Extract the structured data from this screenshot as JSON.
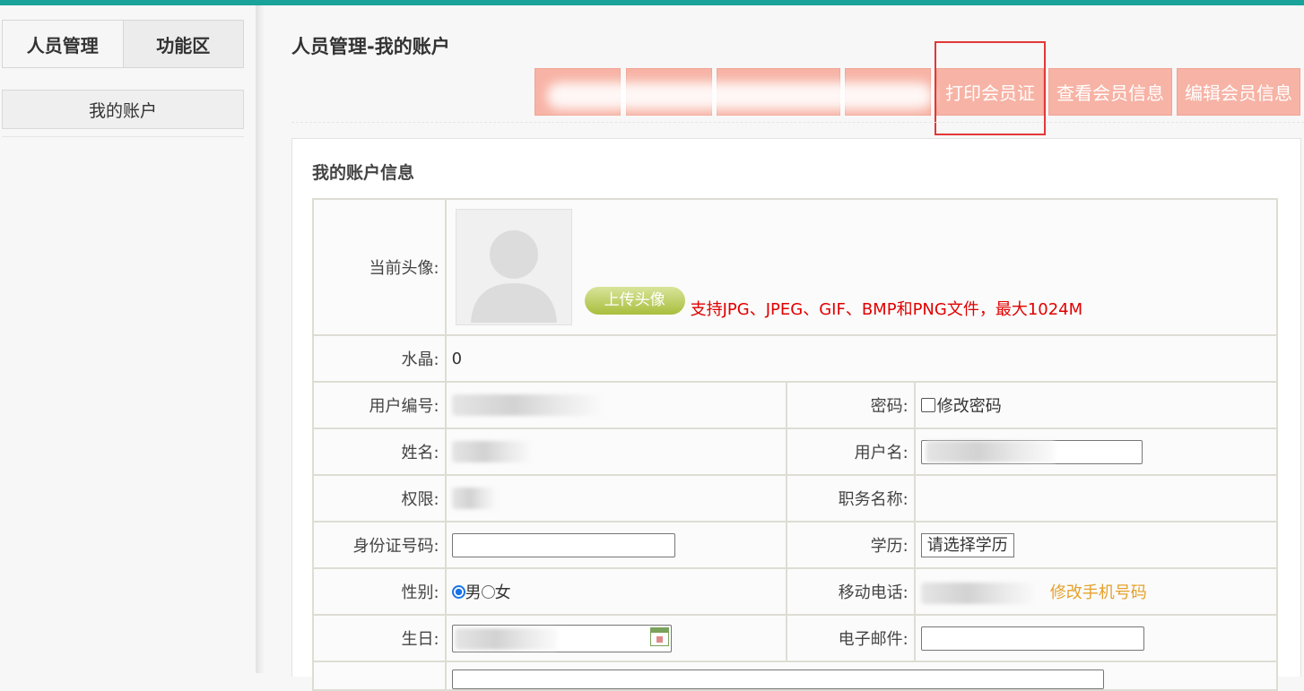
{
  "sidebar": {
    "tabs": [
      "人员管理",
      "功能区"
    ],
    "items": [
      "我的账户"
    ]
  },
  "page_title": "人员管理-我的账户",
  "action_buttons": [
    "",
    "",
    "",
    "",
    "打印会员证",
    "查看会员信息",
    "编辑会员信息"
  ],
  "panel_title": "我的账户信息",
  "avatar": {
    "label": "当前头像:",
    "upload_button": "上传头像",
    "hint": "支持JPG、JPEG、GIF、BMP和PNG文件，最大1024M"
  },
  "fields": {
    "crystal_label": "水晶:",
    "crystal_value": "0",
    "user_no_label": "用户编号:",
    "password_label": "密码:",
    "password_checkbox": "修改密码",
    "name_label": "姓名:",
    "username_label": "用户名:",
    "permission_label": "权限:",
    "job_title_label": "职务名称:",
    "id_card_label": "身份证号码:",
    "education_label": "学历:",
    "education_select": "请选择学历",
    "gender_label": "性别:",
    "gender_options": [
      "男",
      "女"
    ],
    "gender_selected": "男",
    "mobile_label": "移动电话:",
    "mobile_link": "修改手机号码",
    "birthday_label": "生日:",
    "email_label": "电子邮件:"
  },
  "colors": {
    "topbar": "#1aa39a",
    "action_button": "#f7b3a5",
    "highlight": "#e23838",
    "hint": "#e00000",
    "link": "#e4a12b"
  }
}
